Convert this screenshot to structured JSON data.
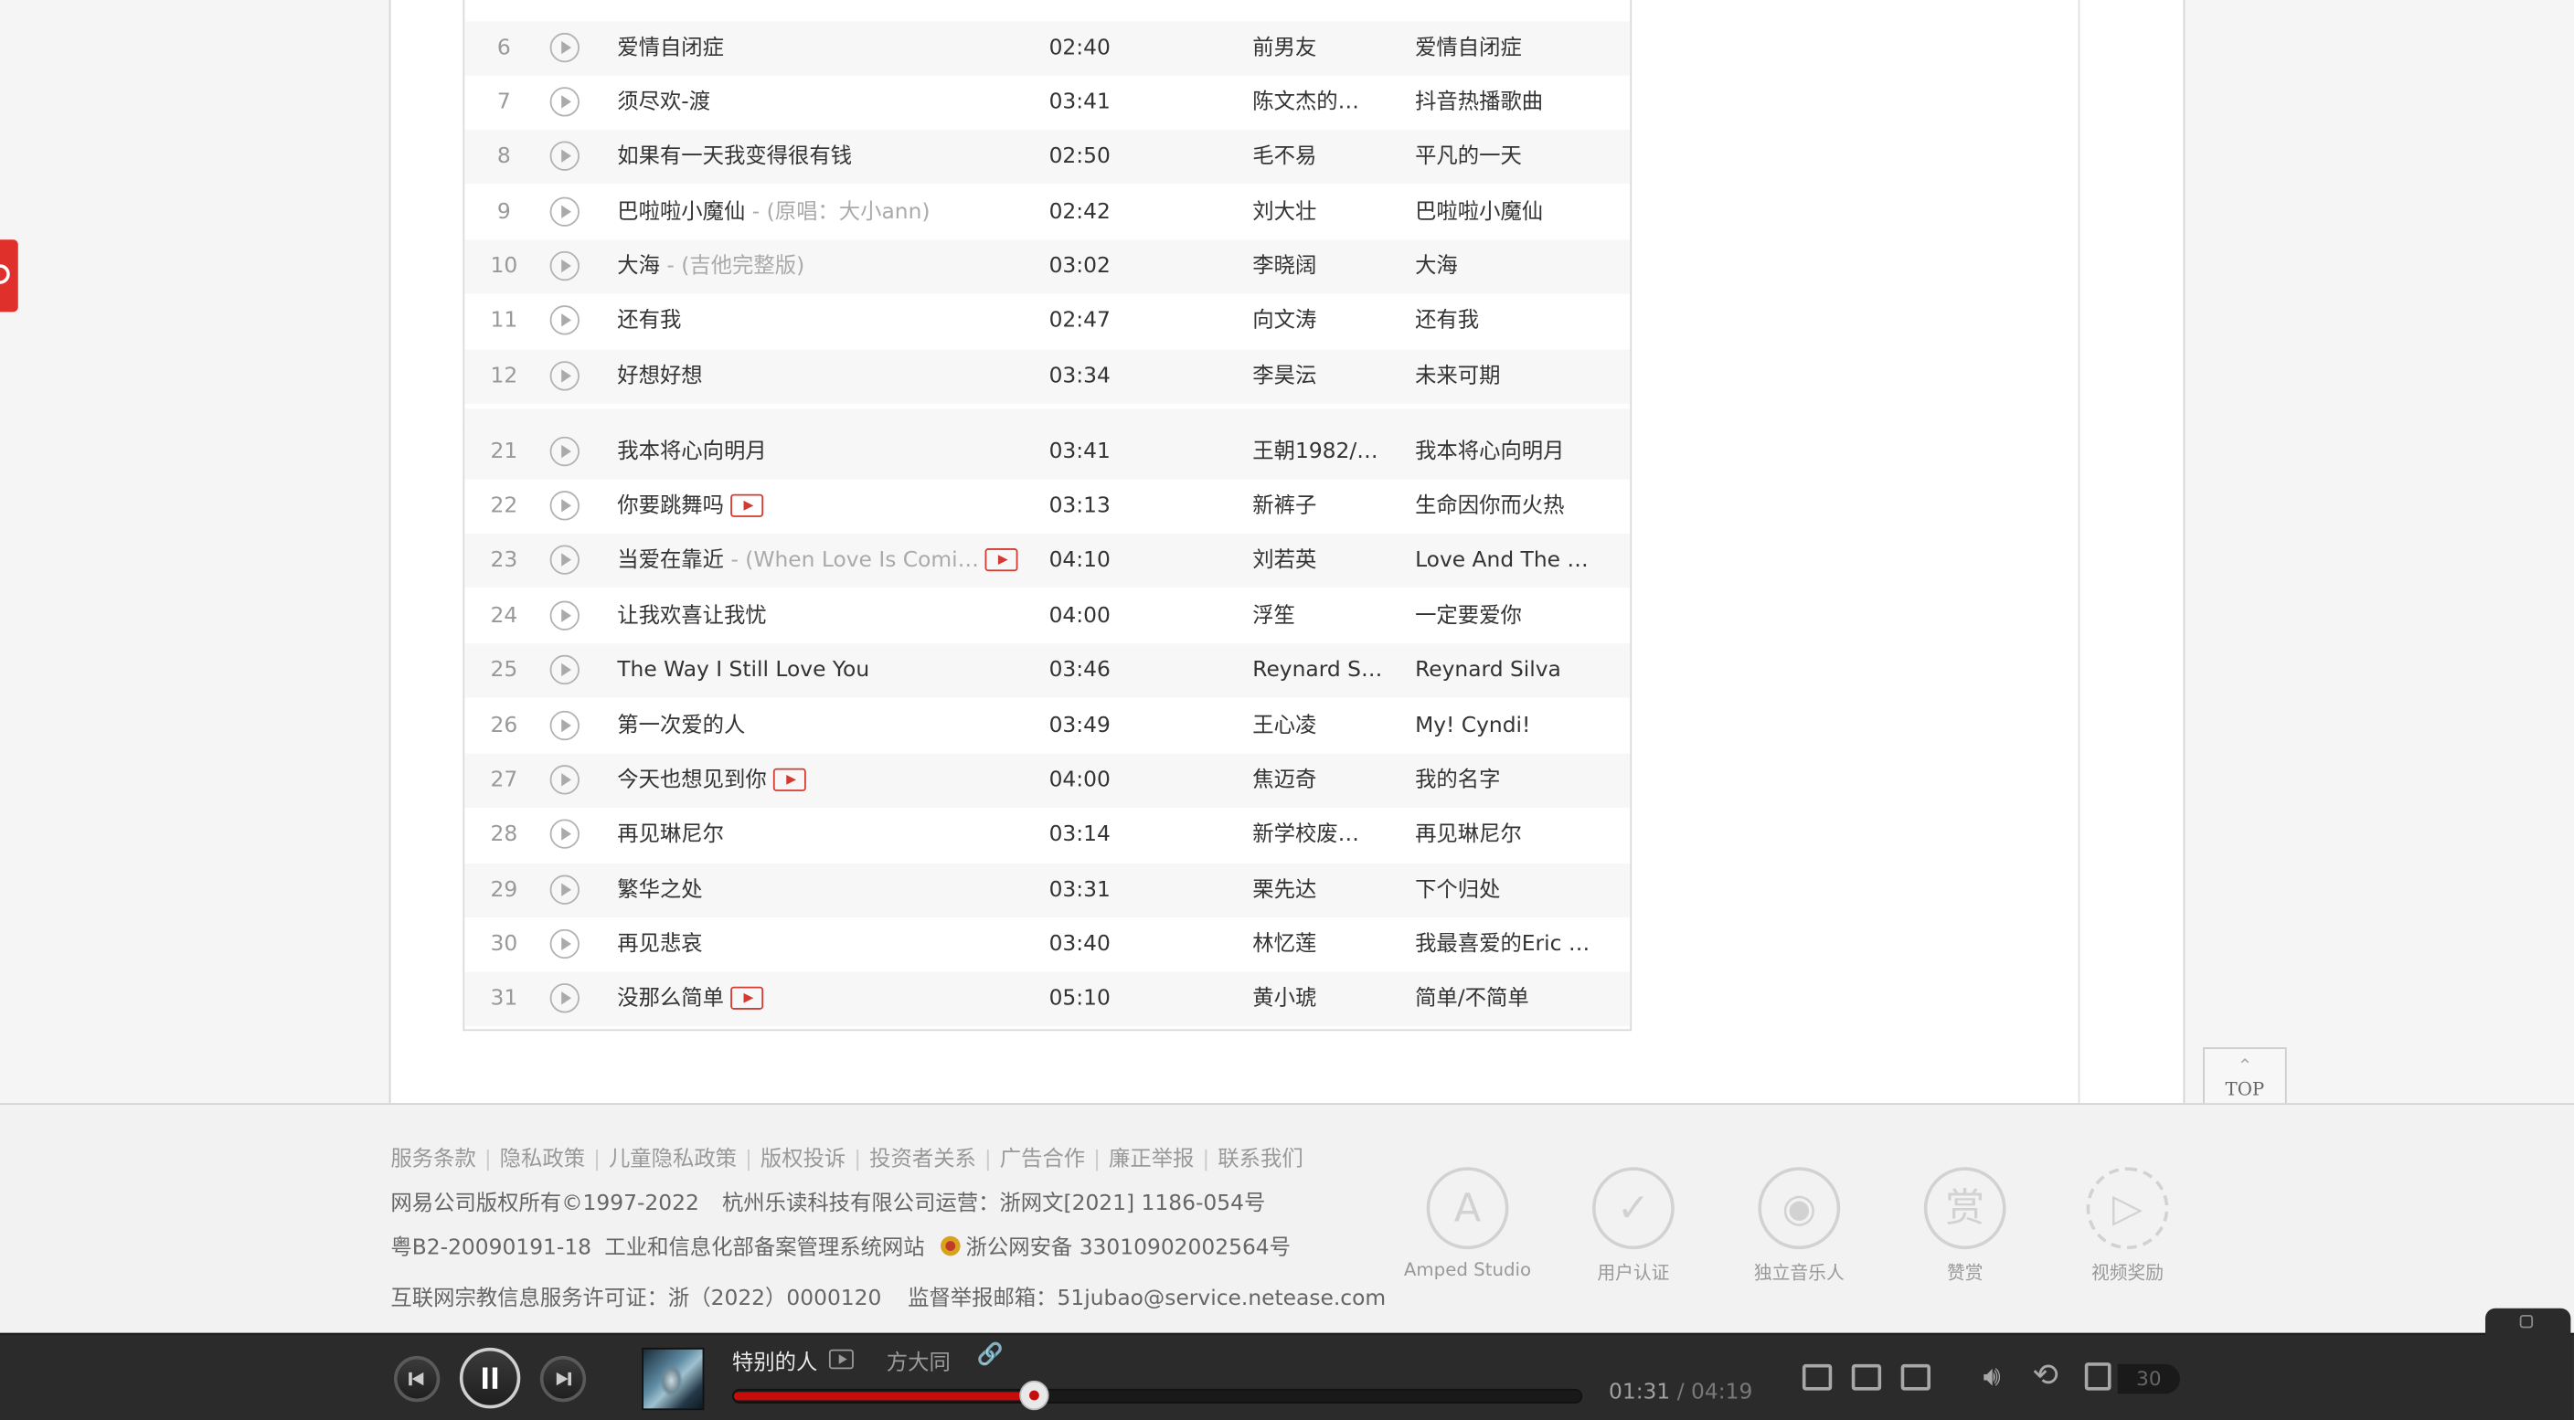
{
  "songs": [
    {
      "idx": "6",
      "title": "爱情自闭症",
      "sub": "",
      "mv": false,
      "duration": "02:40",
      "artist": "前男友",
      "album": "爱情自闭症"
    },
    {
      "idx": "7",
      "title": "须尽欢-渡",
      "sub": "",
      "mv": false,
      "duration": "03:41",
      "artist": "陈文杰的…",
      "album": "抖音热播歌曲"
    },
    {
      "idx": "8",
      "title": "如果有一天我变得很有钱",
      "sub": "",
      "mv": false,
      "duration": "02:50",
      "artist": "毛不易",
      "album": "平凡的一天"
    },
    {
      "idx": "9",
      "title": "巴啦啦小魔仙",
      "sub": " - (原唱：大小ann)",
      "mv": false,
      "duration": "02:42",
      "artist": "刘大壮",
      "album": "巴啦啦小魔仙"
    },
    {
      "idx": "10",
      "title": "大海",
      "sub": " - (吉他完整版)",
      "mv": false,
      "duration": "03:02",
      "artist": "李晓阔",
      "album": "大海"
    },
    {
      "idx": "11",
      "title": "还有我",
      "sub": "",
      "mv": false,
      "duration": "02:47",
      "artist": "向文涛",
      "album": "还有我"
    },
    {
      "idx": "12",
      "title": "好想好想",
      "sub": "",
      "mv": false,
      "duration": "03:34",
      "artist": "李昊沄",
      "album": "未来可期"
    },
    {
      "idx": "21",
      "title": "我本将心向明月",
      "sub": "",
      "mv": false,
      "duration": "03:41",
      "artist": "王朝1982/…",
      "album": "我本将心向明月"
    },
    {
      "idx": "22",
      "title": "你要跳舞吗",
      "sub": "",
      "mv": true,
      "duration": "03:13",
      "artist": "新裤子",
      "album": "生命因你而火热"
    },
    {
      "idx": "23",
      "title": "当爱在靠近",
      "sub": " - (When Love Is Comi…",
      "mv": true,
      "duration": "04:10",
      "artist": "刘若英",
      "album": "Love And The …"
    },
    {
      "idx": "24",
      "title": "让我欢喜让我忧",
      "sub": "",
      "mv": false,
      "duration": "04:00",
      "artist": "浮笙",
      "album": "一定要爱你"
    },
    {
      "idx": "25",
      "title": "The Way I Still Love You",
      "sub": "",
      "mv": false,
      "duration": "03:46",
      "artist": "Reynard S…",
      "album": "Reynard Silva"
    },
    {
      "idx": "26",
      "title": "第一次爱的人",
      "sub": "",
      "mv": false,
      "duration": "03:49",
      "artist": "王心凌",
      "album": "My! Cyndi!"
    },
    {
      "idx": "27",
      "title": "今天也想见到你",
      "sub": "",
      "mv": true,
      "duration": "04:00",
      "artist": "焦迈奇",
      "album": "我的名字"
    },
    {
      "idx": "28",
      "title": "再见琳尼尔",
      "sub": "",
      "mv": false,
      "duration": "03:14",
      "artist": "新学校废…",
      "album": "再见琳尼尔"
    },
    {
      "idx": "29",
      "title": "繁华之处",
      "sub": "",
      "mv": false,
      "duration": "03:31",
      "artist": "栗先达",
      "album": "下个归处"
    },
    {
      "idx": "30",
      "title": "再见悲哀",
      "sub": "",
      "mv": false,
      "duration": "03:40",
      "artist": "林忆莲",
      "album": "我最喜爱的Eric …"
    },
    {
      "idx": "31",
      "title": "没那么简单",
      "sub": "",
      "mv": true,
      "duration": "05:10",
      "artist": "黄小琥",
      "album": "简单/不简单"
    }
  ],
  "top_button": {
    "label": "TOP"
  },
  "footer": {
    "links": [
      "服务条款",
      "隐私政策",
      "儿童隐私政策",
      "版权投诉",
      "投资者关系",
      "广告合作",
      "廉正举报",
      "联系我们"
    ],
    "copyright": "网易公司版权所有©1997-2022",
    "operator": "杭州乐读科技有限公司运营：浙网文[2021] 1186-054号",
    "icp": "粤B2-20090191-18",
    "icp_link": "工业和信息化部备案管理系统网站",
    "police": "浙公网安备 33010902002564号",
    "religion_license": "互联网宗教信息服务许可证：浙（2022）0000120",
    "report_email": "监督举报邮箱：51jubao@service.netease.com",
    "badges": [
      {
        "label": "Amped Studio",
        "icon": "amped-studio-icon",
        "glyph": "A"
      },
      {
        "label": "用户认证",
        "icon": "shield-check-icon",
        "glyph": "✓"
      },
      {
        "label": "独立音乐人",
        "icon": "disc-icon",
        "glyph": "◉"
      },
      {
        "label": "赞赏",
        "icon": "reward-icon",
        "glyph": "赏"
      },
      {
        "label": "视频奖励",
        "icon": "video-play-icon",
        "glyph": "▷"
      }
    ]
  },
  "player": {
    "song_title": "特别的人",
    "artist": "方大同",
    "current_time": "01:31",
    "separator": "/",
    "total_time": "04:19",
    "progress_fraction": 0.355,
    "playlist_count": "30",
    "accent_color": "#c70c0c"
  }
}
